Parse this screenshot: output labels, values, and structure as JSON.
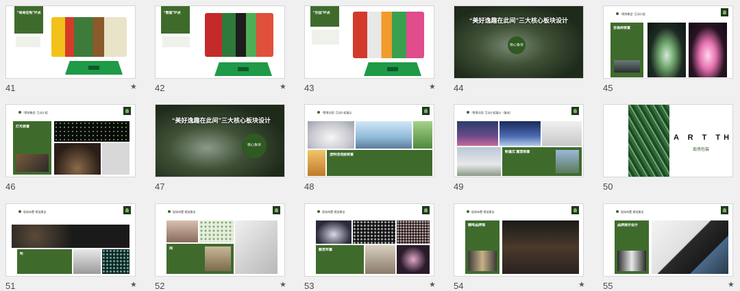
{
  "slides": [
    {
      "number": "41",
      "starred": true,
      "label": "“哥哥在呢”IP点"
    },
    {
      "number": "42",
      "starred": true,
      "label": "“熊猫”IP点"
    },
    {
      "number": "43",
      "starred": true,
      "label": "“乐园”IP点"
    },
    {
      "number": "44",
      "starred": false,
      "title": "“美好逸趣在此间”三大核心板块设计",
      "circle_text": "核心板块"
    },
    {
      "number": "45",
      "starred": false,
      "header": "“缤纷聚会” 互动小组",
      "box_title": "圣诞树装置"
    },
    {
      "number": "46",
      "starred": false,
      "header": "“缤纷聚会” 互动小组",
      "box_title": "灯光装置"
    },
    {
      "number": "47",
      "starred": false,
      "title": "“美好逸趣在此间”三大核心板块设计",
      "circle_text": "核心板块"
    },
    {
      "number": "48",
      "starred": false,
      "header": "“雪境乐园” 互动小组展示",
      "box_title": "透明泡泡屋装置"
    },
    {
      "number": "49",
      "starred": false,
      "header": "“雪境乐园” 互动小组展示（备选）",
      "box_title": "帐篷式 露营装置"
    },
    {
      "number": "50",
      "starred": false,
      "art": "A R T    THREE",
      "subtitle": "现场包装"
    },
    {
      "number": "51",
      "starred": true,
      "header": "现场布置·视觉建议",
      "box_title": "听"
    },
    {
      "number": "52",
      "starred": true,
      "header": "现场布置·视觉建议",
      "box_title": "闻"
    },
    {
      "number": "53",
      "starred": true,
      "header": "现场布置·视觉建议",
      "box_title": "触觉布置"
    },
    {
      "number": "54",
      "starred": true,
      "header": "现场布置·视觉建议",
      "box_title": "趣味品牌墙"
    },
    {
      "number": "55",
      "starred": true,
      "header": "现场布置·视觉建议",
      "box_title": "品牌展示设计"
    }
  ],
  "colors": {
    "accent": "#3e6b2c",
    "dark_green": "#2e4a26",
    "stage": "#1f9a47",
    "background": "#f0f0f0"
  }
}
